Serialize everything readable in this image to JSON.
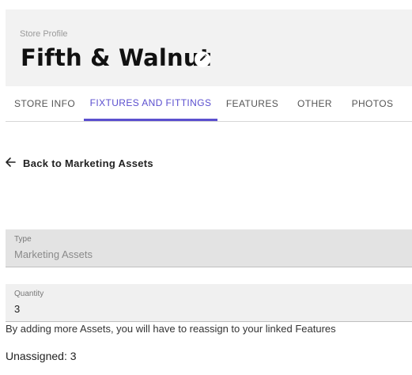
{
  "header": {
    "eyebrow": "Store Profile",
    "title": "Fifth & Walnut",
    "edit_icon": "pencil-icon"
  },
  "tabs": [
    {
      "label": "STORE INFO",
      "active": false
    },
    {
      "label": "FIXTURES AND FITTINGS",
      "active": true
    },
    {
      "label": "FEATURES",
      "active": false
    },
    {
      "label": "OTHER",
      "active": false
    },
    {
      "label": "PHOTOS",
      "active": false
    }
  ],
  "back_link": {
    "label": "Back to Marketing Assets",
    "icon": "arrow-left-icon"
  },
  "form": {
    "type": {
      "label": "Type",
      "value": "Marketing Assets",
      "disabled": true
    },
    "quantity": {
      "label": "Quantity",
      "value": "3"
    }
  },
  "helper_text": "By adding more Assets, you will have to reassign to your linked Features",
  "unassigned_text": "Unassigned: 3",
  "colors": {
    "accent": "#5b4fcf",
    "header_bg": "#f2f2f2"
  }
}
